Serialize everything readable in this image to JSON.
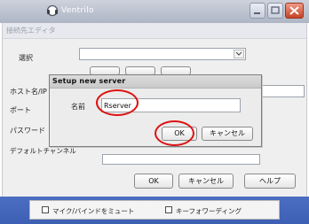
{
  "app": {
    "title": "Ventrilo"
  },
  "editor": {
    "title": "接続先エディタ",
    "select_label": "選択",
    "host_label": "ホスト名/IP",
    "port_label": "ポート",
    "password_label": "パスワード",
    "default_channel_label": "デフォルトチャンネル",
    "ok_label": "OK",
    "cancel_label": "キャンセル",
    "help_label": "ヘルプ"
  },
  "dialog": {
    "title": "Setup new server",
    "name_label": "名前",
    "name_value": "Rserver",
    "ok_label": "OK",
    "cancel_label": "キャンセル"
  },
  "footer": {
    "mic_bind_label": "マイク/バインドをミュート",
    "keyword_label": "キーフォワーディング"
  },
  "colors": {
    "highlight_circle": "#dc1212",
    "taskbar": "#4565b8"
  }
}
